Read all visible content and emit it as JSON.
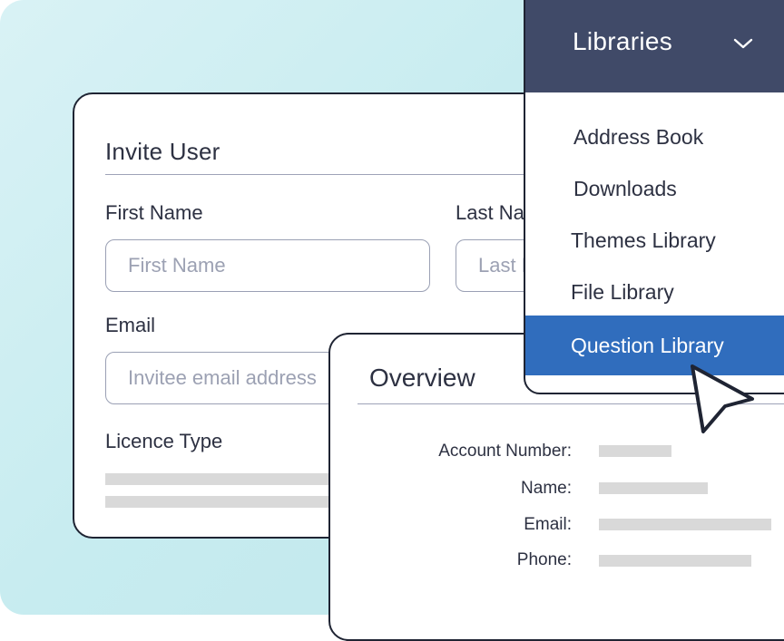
{
  "invite": {
    "title": "Invite User",
    "first_name": {
      "label": "First Name",
      "placeholder": "First Name"
    },
    "last_name": {
      "label": "Last Name",
      "placeholder": "Last Name"
    },
    "email": {
      "label": "Email",
      "placeholder": "Invitee email address"
    },
    "licence": {
      "label": "Licence Type"
    }
  },
  "overview": {
    "title": "Overview",
    "fields": [
      {
        "label": "Account Number:"
      },
      {
        "label": "Name:"
      },
      {
        "label": "Email:"
      },
      {
        "label": "Phone:"
      }
    ]
  },
  "libraries": {
    "title": "Libraries",
    "items": [
      {
        "label": "Address Book"
      },
      {
        "label": "Downloads"
      },
      {
        "label": "Themes Library"
      },
      {
        "label": "File Library"
      },
      {
        "label": "Question Library",
        "active": true
      }
    ]
  },
  "colors": {
    "header_bg": "#404a68",
    "active_item": "#306dbd",
    "background": "#c7ecf0",
    "border": "#1f2433"
  },
  "icons": [
    "chevron-down-icon",
    "mouse-pointer-icon"
  ]
}
